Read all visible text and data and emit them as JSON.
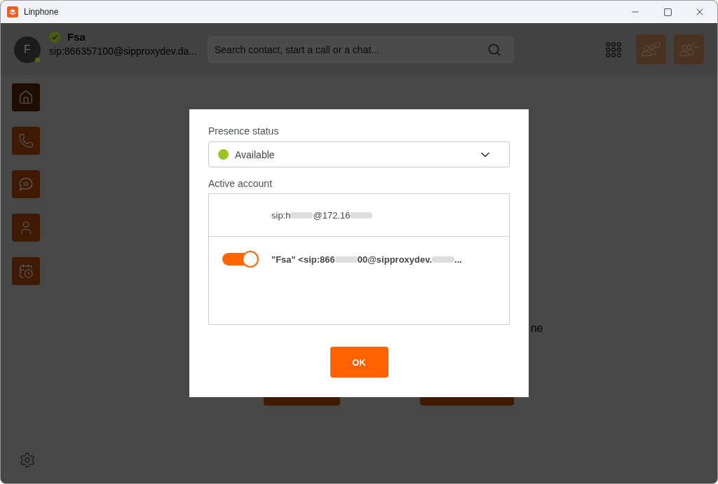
{
  "window": {
    "title": "Linphone"
  },
  "header": {
    "avatar_initial": "F",
    "name": "Fsa",
    "address": "sip:866357100@sipproxydev.da...",
    "search": {
      "placeholder": "Search contact, start a call or a chat..."
    }
  },
  "sidebar": {
    "items": [
      {
        "selected": true
      },
      {
        "selected": false
      },
      {
        "selected": false
      },
      {
        "selected": false
      },
      {
        "selected": false
      }
    ]
  },
  "main": {
    "text": "ne"
  },
  "dialog": {
    "presence_label": "Presence status",
    "presence_select": {
      "value": "Available"
    },
    "account_label": "Active account",
    "accounts": [
      {
        "kind": "plain",
        "address": [
          {
            "kind": "text",
            "text": "sip:h"
          },
          {
            "kind": "blur"
          },
          {
            "kind": "text",
            "text": "@172.16"
          },
          {
            "kind": "blur"
          }
        ]
      },
      {
        "kind": "toggle",
        "on": true,
        "address": [
          {
            "kind": "text",
            "text": "\"Fsa\" <sip:866"
          },
          {
            "kind": "blur"
          },
          {
            "kind": "text",
            "text": "00@sipproxydev."
          },
          {
            "kind": "blur"
          },
          {
            "kind": "text",
            "text": "..."
          }
        ]
      }
    ],
    "ok_button": "OK"
  }
}
